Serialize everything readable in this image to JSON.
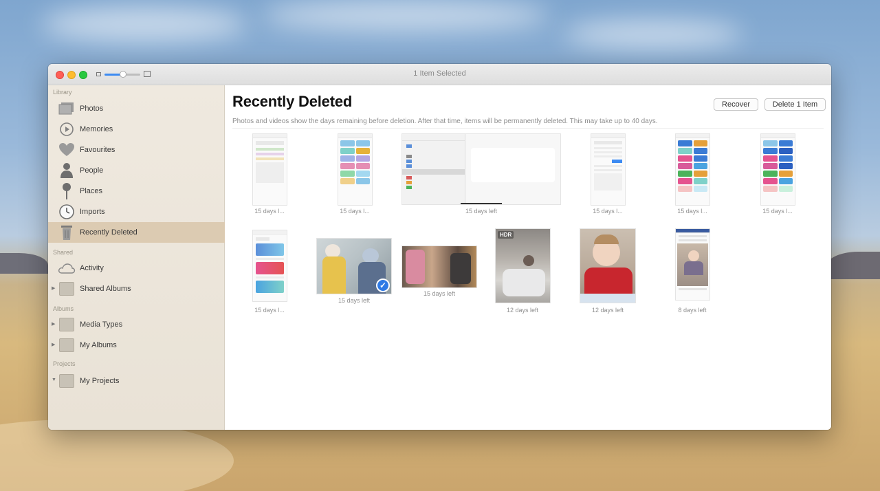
{
  "window": {
    "title": "1 Item Selected"
  },
  "sidebar": {
    "sections": {
      "library": "Library",
      "shared": "Shared",
      "albums": "Albums",
      "projects": "Projects"
    },
    "items": [
      {
        "label": "Photos",
        "icon": "photos-icon"
      },
      {
        "label": "Memories",
        "icon": "memories-icon"
      },
      {
        "label": "Favourites",
        "icon": "heart-icon"
      },
      {
        "label": "People",
        "icon": "person-icon"
      },
      {
        "label": "Places",
        "icon": "pin-icon"
      },
      {
        "label": "Imports",
        "icon": "clock-icon"
      },
      {
        "label": "Recently Deleted",
        "icon": "trash-icon",
        "selected": true
      },
      {
        "label": "Activity",
        "icon": "cloud-icon"
      },
      {
        "label": "Shared Albums",
        "icon": "folder-icon"
      },
      {
        "label": "Media Types",
        "icon": "folder-icon"
      },
      {
        "label": "My Albums",
        "icon": "folder-icon"
      },
      {
        "label": "My Projects",
        "icon": "folder-icon"
      }
    ]
  },
  "main": {
    "title": "Recently Deleted",
    "subtitle": "Photos and videos show the days remaining before deletion. After that time, items will be permanently deleted. This may take up to 40 days.",
    "recover_label": "Recover",
    "delete_label": "Delete 1 Item"
  },
  "photos": [
    {
      "caption": "15 days l..."
    },
    {
      "caption": "15 days l..."
    },
    {
      "caption": "15 days left"
    },
    {
      "caption": "15 days l..."
    },
    {
      "caption": "15 days l..."
    },
    {
      "caption": "15 days l..."
    },
    {
      "caption": "15 days l..."
    },
    {
      "caption": "15 days left",
      "selected": true
    },
    {
      "caption": "15 days left"
    },
    {
      "caption": "12 days left",
      "badge": "HDR"
    },
    {
      "caption": "12 days left"
    },
    {
      "caption": "8 days left"
    }
  ],
  "colors": {
    "accent": "#2f7ae5",
    "sidebar_selected": "#dccbb2"
  }
}
